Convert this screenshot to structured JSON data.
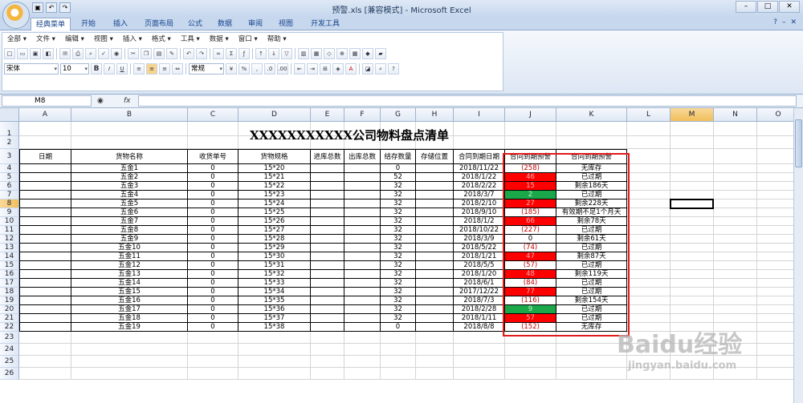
{
  "window": {
    "title": "预警.xls  [兼容模式] - Microsoft Excel",
    "controls": [
      "–",
      "□",
      "✕"
    ],
    "qat_icons": [
      "save-icon",
      "undo-icon",
      "redo-icon"
    ]
  },
  "tabs": [
    "经典菜单",
    "开始",
    "插入",
    "页面布局",
    "公式",
    "数据",
    "审阅",
    "视图",
    "开发工具"
  ],
  "help_icons": [
    "?",
    "–",
    "✕"
  ],
  "menu": [
    "全部 ▾",
    "文件 ▾",
    "编辑 ▾",
    "视图 ▾",
    "插入 ▾",
    "格式 ▾",
    "工具 ▾",
    "数据 ▾",
    "窗口 ▾",
    "帮助 ▾"
  ],
  "format_bar": {
    "font": "宋体",
    "size": "10",
    "number_format": "常规"
  },
  "formula_bar": {
    "name_box": "M8",
    "fx": "fx",
    "value": ""
  },
  "columns": [
    "A",
    "B",
    "C",
    "D",
    "E",
    "F",
    "G",
    "H",
    "I",
    "J",
    "K",
    "L",
    "M",
    "N",
    "O"
  ],
  "rows": [
    "1",
    "2",
    "3",
    "4",
    "5",
    "6",
    "7",
    "8",
    "9",
    "10",
    "11",
    "12",
    "13",
    "14",
    "15",
    "16",
    "17",
    "18",
    "19",
    "20",
    "21",
    "22",
    "23",
    "24",
    "25",
    "26"
  ],
  "selected_col": "M",
  "selected_row": "8",
  "sheet_title": "XXXXXXXXXXX公司物料盘点清单",
  "headers": [
    "日期",
    "货物名称",
    "收货单号",
    "货物规格",
    "进库总数",
    "出库总数",
    "结存数量",
    "存储位置",
    "合同到期日期",
    "合同到期预警",
    "合同到期预警"
  ],
  "data_rows": [
    [
      "五金1",
      "0",
      "15*20",
      "0",
      "2018/11/22",
      "(258)",
      "无库存",
      "neg"
    ],
    [
      "五金2",
      "0",
      "15*21",
      "52",
      "2018/1/22",
      "46",
      "已过期",
      "red"
    ],
    [
      "五金3",
      "0",
      "15*22",
      "32",
      "2018/2/22",
      "15",
      "剩余186天",
      "red"
    ],
    [
      "五金4",
      "0",
      "15*23",
      "32",
      "2018/3/7",
      "2",
      "已过期",
      "green"
    ],
    [
      "五金5",
      "0",
      "15*24",
      "32",
      "2018/2/10",
      "27",
      "剩余228天",
      "red"
    ],
    [
      "五金6",
      "0",
      "15*25",
      "32",
      "2018/9/10",
      "(185)",
      "有效期不足1个月天",
      "neg"
    ],
    [
      "五金7",
      "0",
      "15*26",
      "32",
      "2018/1/2",
      "66",
      "剩余78天",
      "red"
    ],
    [
      "五金8",
      "0",
      "15*27",
      "32",
      "2018/10/22",
      "(227)",
      "已过期",
      "neg"
    ],
    [
      "五金9",
      "0",
      "15*28",
      "32",
      "2018/3/9",
      "0",
      "剩余61天",
      "none"
    ],
    [
      "五金10",
      "0",
      "15*29",
      "32",
      "2018/5/22",
      "(74)",
      "已过期",
      "neg"
    ],
    [
      "五金11",
      "0",
      "15*30",
      "32",
      "2018/1/21",
      "47",
      "剩余87天",
      "red"
    ],
    [
      "五金12",
      "0",
      "15*31",
      "32",
      "2018/5/5",
      "(57)",
      "已过期",
      "neg"
    ],
    [
      "五金13",
      "0",
      "15*32",
      "32",
      "2018/1/20",
      "48",
      "剩余119天",
      "red"
    ],
    [
      "五金14",
      "0",
      "15*33",
      "32",
      "2018/6/1",
      "(84)",
      "已过期",
      "neg"
    ],
    [
      "五金15",
      "0",
      "15*34",
      "32",
      "2017/12/22",
      "77",
      "已过期",
      "red"
    ],
    [
      "五金16",
      "0",
      "15*35",
      "32",
      "2018/7/3",
      "(116)",
      "剩余154天",
      "neg"
    ],
    [
      "五金17",
      "0",
      "15*36",
      "32",
      "2018/2/28",
      "9",
      "已过期",
      "green"
    ],
    [
      "五金18",
      "0",
      "15*37",
      "32",
      "2018/1/11",
      "57",
      "已过期",
      "red"
    ],
    [
      "五金19",
      "0",
      "15*38",
      "0",
      "2018/8/8",
      "(152)",
      "无库存",
      "neg"
    ]
  ],
  "watermark": {
    "logo": "Baidu经验",
    "url": "jingyan.baidu.com"
  }
}
